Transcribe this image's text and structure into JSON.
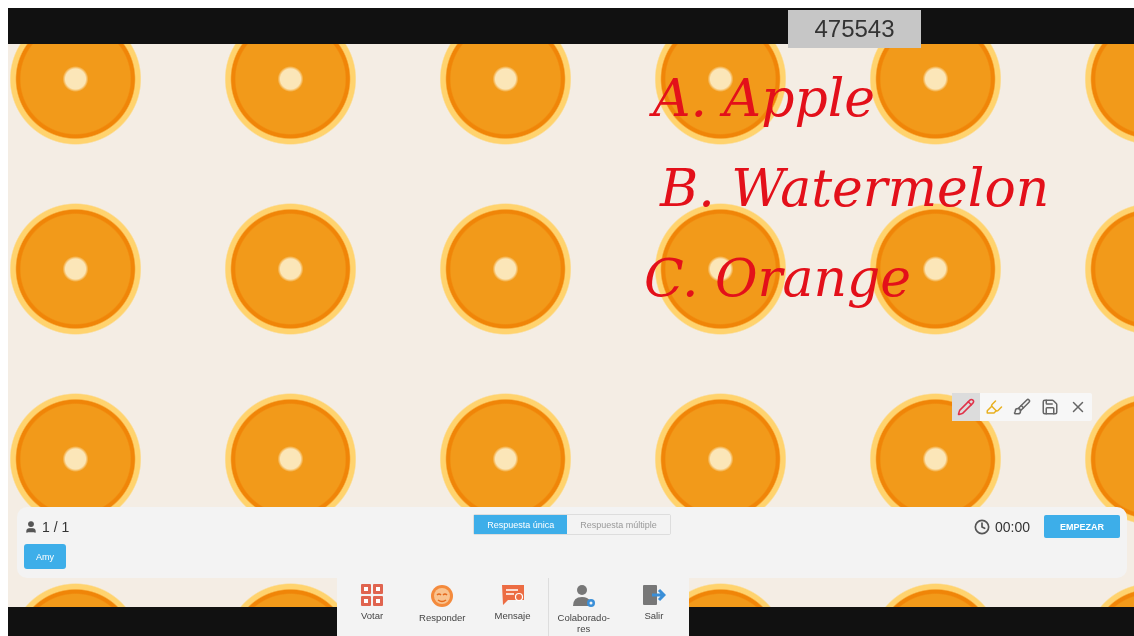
{
  "session_code": "475543",
  "annotations": [
    "A. Apple",
    "B. Watermelon",
    "C. Orange"
  ],
  "pen_tools": [
    {
      "kind": "pencil",
      "selected": true
    },
    {
      "kind": "highlighter",
      "selected": false
    },
    {
      "kind": "broom",
      "selected": false
    },
    {
      "kind": "save",
      "selected": false
    },
    {
      "kind": "close",
      "selected": false
    }
  ],
  "answer_panel": {
    "participants": "1 / 1",
    "answer_modes": [
      {
        "label": "Respuesta única",
        "selected": true
      },
      {
        "label": "Respuesta múltiple",
        "selected": false
      }
    ],
    "timer": "00:00",
    "start_button": "EMPEZAR",
    "students": [
      {
        "name": "Amy"
      }
    ]
  },
  "toolbar": [
    {
      "kind": "vote",
      "label": "Votar"
    },
    {
      "kind": "respond",
      "label": "Responder"
    },
    {
      "kind": "message",
      "label": "Mensaje"
    },
    {
      "kind": "collaborators",
      "label": "Colaborado-res"
    },
    {
      "kind": "exit",
      "label": "Salir"
    }
  ]
}
